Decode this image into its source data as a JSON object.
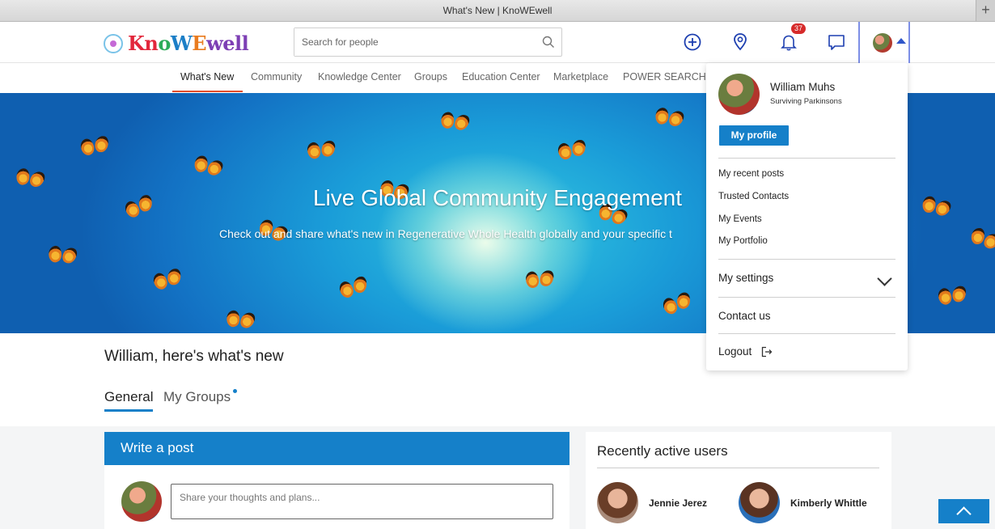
{
  "window": {
    "title": "What's New | KnoWEwell",
    "new_tab_label": "+"
  },
  "header": {
    "logo": {
      "parts": [
        "Kn",
        "o",
        "W",
        "E",
        "well"
      ]
    },
    "search": {
      "placeholder": "Search for people",
      "value": ""
    },
    "icons": [
      "plus-circle-icon",
      "location-pin-icon",
      "bell-icon",
      "chat-icon",
      "user-avatar",
      "caret-up-icon"
    ],
    "notifications_count": "37",
    "accent_color": "#1580c9"
  },
  "nav": {
    "items": [
      {
        "label": "What's New",
        "active": true
      },
      {
        "label": "Community"
      },
      {
        "label": "Knowledge Center"
      },
      {
        "label": "Groups"
      },
      {
        "label": "Education Center"
      },
      {
        "label": "Marketplace"
      },
      {
        "label": "POWER SEARCH"
      }
    ],
    "active_color": "#e14d2a"
  },
  "hero": {
    "title": "Live Global Community Engagement",
    "subtitle": "Check out and share what's new in Regenerative Whole Health globally and your specific t"
  },
  "feed": {
    "greeting": "William, here's what's new",
    "tabs": [
      {
        "label": "General",
        "active": true
      },
      {
        "label": "My Groups",
        "has_dot": true
      }
    ]
  },
  "write_post": {
    "title": "Write a post",
    "placeholder": "Share your thoughts and plans..."
  },
  "recent_users": {
    "title": "Recently active users",
    "users": [
      {
        "name": "Jennie Jerez"
      },
      {
        "name": "Kimberly Whittle"
      }
    ]
  },
  "profile_menu": {
    "name": "William Muhs",
    "subtitle": "Surviving Parkinsons",
    "profile_button": "My profile",
    "links": [
      "My recent posts",
      "Trusted Contacts",
      "My Events",
      "My Portfolio"
    ],
    "settings_label": "My settings",
    "contact_label": "Contact us",
    "logout_label": "Logout"
  }
}
